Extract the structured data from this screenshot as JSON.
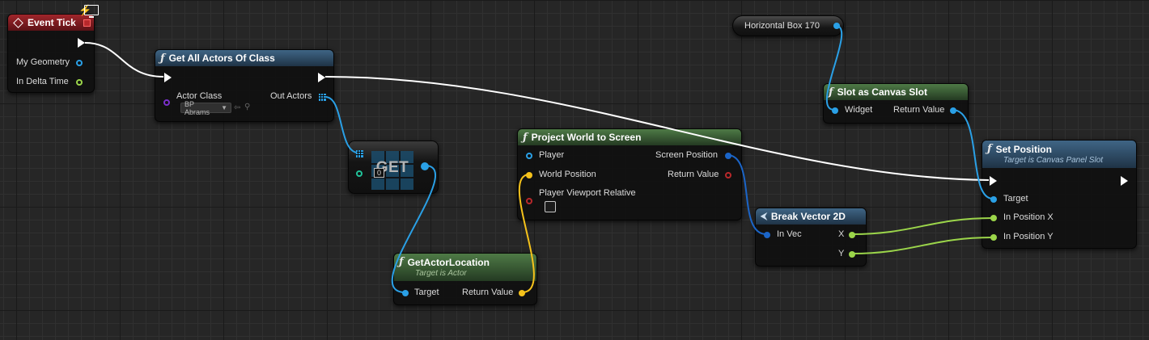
{
  "nodes": {
    "event_tick": {
      "title": "Event Tick",
      "pins": {
        "my_geometry": "My Geometry",
        "in_delta_time": "In Delta Time"
      }
    },
    "get_all_actors": {
      "title": "Get All Actors Of Class",
      "pins": {
        "actor_class": "Actor Class",
        "actor_class_value": "BP Abrams",
        "out_actors": "Out Actors"
      }
    },
    "get_array": {
      "title": "GET",
      "index_value": "0"
    },
    "get_actor_location": {
      "title": "GetActorLocation",
      "subtitle": "Target is Actor",
      "pins": {
        "target": "Target",
        "return_value": "Return Value"
      }
    },
    "project_world_to_screen": {
      "title": "Project World to Screen",
      "pins": {
        "player": "Player",
        "screen_position": "Screen Position",
        "world_position": "World Position",
        "return_value": "Return Value",
        "player_viewport_relative": "Player Viewport Relative"
      }
    },
    "horizontal_box": {
      "title": "Horizontal Box 170"
    },
    "slot_as_canvas_slot": {
      "title": "Slot as Canvas Slot",
      "pins": {
        "widget": "Widget",
        "return_value": "Return Value"
      }
    },
    "break_vector_2d": {
      "title": "Break Vector 2D",
      "pins": {
        "in_vec": "In Vec",
        "x": "X",
        "y": "Y"
      }
    },
    "set_position": {
      "title": "Set Position",
      "subtitle": "Target is Canvas Panel Slot",
      "pins": {
        "target": "Target",
        "in_position_x": "In Position X",
        "in_position_y": "In Position Y"
      }
    }
  },
  "icons": {
    "function": "ƒ",
    "event": "event-diamond-icon",
    "break_vector": "break-struct-icon",
    "monitor": "monitor-icon",
    "lightning": "lightning-icon"
  },
  "colors": {
    "background": "#262626",
    "exec_wire": "#ffffff",
    "object_wire": "#2aa0e6",
    "vector_wire": "#f5c21b",
    "vector2d_wire": "#1b65c8",
    "float_wire": "#9bd54a",
    "event_header": "#a0262b",
    "function_header": "#3f6585",
    "pure_header": "#4e7a46"
  }
}
